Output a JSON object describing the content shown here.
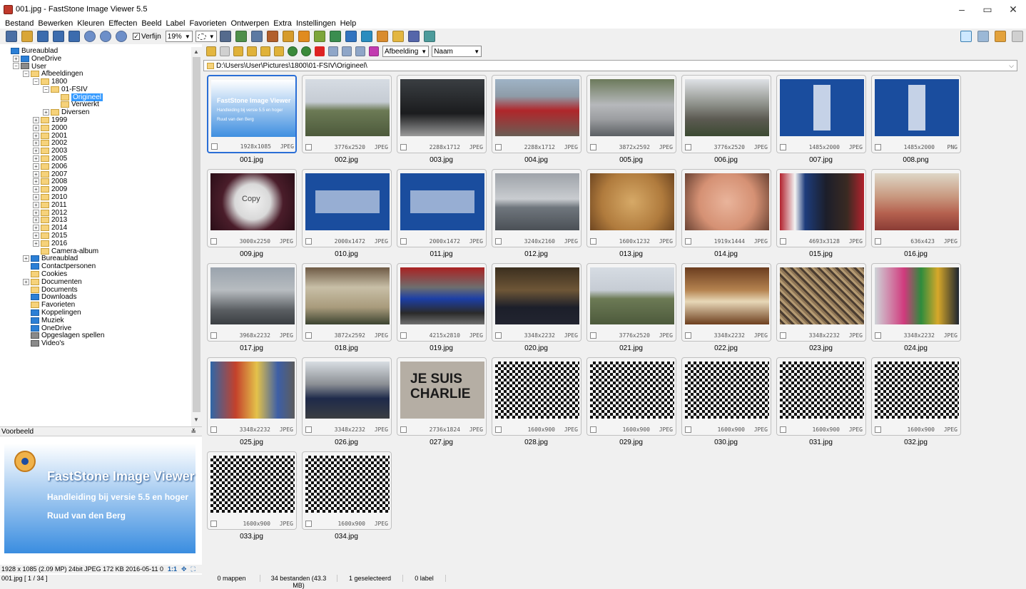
{
  "window": {
    "title": "001.jpg - FastStone Image Viewer 5.5",
    "min": "–",
    "max": "▭",
    "close": "✕"
  },
  "menu": [
    "Bestand",
    "Bewerken",
    "Kleuren",
    "Effecten",
    "Beeld",
    "Label",
    "Favorieten",
    "Ontwerpen",
    "Extra",
    "Instellingen",
    "Help"
  ],
  "toolbar": {
    "refine_label": "Verfijn",
    "zoom_value": "19%"
  },
  "nav_toolbar": {
    "sort_label": "Afbeelding",
    "sort_by": "Naam"
  },
  "path": "D:\\Users\\User\\Pictures\\1800\\01-FSIV\\Origineel\\",
  "tree": [
    {
      "label": "Bureaublad",
      "indent": 0,
      "exp": "",
      "icon": "blue"
    },
    {
      "label": "OneDrive",
      "indent": 1,
      "exp": "+",
      "icon": "blue"
    },
    {
      "label": "User",
      "indent": 1,
      "exp": "-",
      "icon": "grey"
    },
    {
      "label": "Afbeeldingen",
      "indent": 2,
      "exp": "-",
      "icon": "folder"
    },
    {
      "label": "1800",
      "indent": 3,
      "exp": "-",
      "icon": "folder"
    },
    {
      "label": "01-FSIV",
      "indent": 4,
      "exp": "-",
      "icon": "folder"
    },
    {
      "label": "Origineel",
      "indent": 5,
      "exp": "",
      "icon": "folder",
      "selected": true
    },
    {
      "label": "Verwerkt",
      "indent": 5,
      "exp": "",
      "icon": "folder"
    },
    {
      "label": "Diversen",
      "indent": 4,
      "exp": "+",
      "icon": "folder"
    },
    {
      "label": "1999",
      "indent": 3,
      "exp": "+",
      "icon": "folder"
    },
    {
      "label": "2000",
      "indent": 3,
      "exp": "+",
      "icon": "folder"
    },
    {
      "label": "2001",
      "indent": 3,
      "exp": "+",
      "icon": "folder"
    },
    {
      "label": "2002",
      "indent": 3,
      "exp": "+",
      "icon": "folder"
    },
    {
      "label": "2003",
      "indent": 3,
      "exp": "+",
      "icon": "folder"
    },
    {
      "label": "2005",
      "indent": 3,
      "exp": "+",
      "icon": "folder"
    },
    {
      "label": "2006",
      "indent": 3,
      "exp": "+",
      "icon": "folder"
    },
    {
      "label": "2007",
      "indent": 3,
      "exp": "+",
      "icon": "folder"
    },
    {
      "label": "2008",
      "indent": 3,
      "exp": "+",
      "icon": "folder"
    },
    {
      "label": "2009",
      "indent": 3,
      "exp": "+",
      "icon": "folder"
    },
    {
      "label": "2010",
      "indent": 3,
      "exp": "+",
      "icon": "folder"
    },
    {
      "label": "2011",
      "indent": 3,
      "exp": "+",
      "icon": "folder"
    },
    {
      "label": "2012",
      "indent": 3,
      "exp": "+",
      "icon": "folder"
    },
    {
      "label": "2013",
      "indent": 3,
      "exp": "+",
      "icon": "folder"
    },
    {
      "label": "2014",
      "indent": 3,
      "exp": "+",
      "icon": "folder"
    },
    {
      "label": "2015",
      "indent": 3,
      "exp": "+",
      "icon": "folder"
    },
    {
      "label": "2016",
      "indent": 3,
      "exp": "+",
      "icon": "folder"
    },
    {
      "label": "Camera-album",
      "indent": 3,
      "exp": "",
      "icon": "folder"
    },
    {
      "label": "Bureaublad",
      "indent": 2,
      "exp": "+",
      "icon": "blue"
    },
    {
      "label": "Contactpersonen",
      "indent": 2,
      "exp": "",
      "icon": "blue"
    },
    {
      "label": "Cookies",
      "indent": 2,
      "exp": "",
      "icon": "folder"
    },
    {
      "label": "Documenten",
      "indent": 2,
      "exp": "+",
      "icon": "folder"
    },
    {
      "label": "Documents",
      "indent": 2,
      "exp": "",
      "icon": "folder"
    },
    {
      "label": "Downloads",
      "indent": 2,
      "exp": "",
      "icon": "blue"
    },
    {
      "label": "Favorieten",
      "indent": 2,
      "exp": "",
      "icon": "folder"
    },
    {
      "label": "Koppelingen",
      "indent": 2,
      "exp": "",
      "icon": "blue"
    },
    {
      "label": "Muziek",
      "indent": 2,
      "exp": "",
      "icon": "blue"
    },
    {
      "label": "OneDrive",
      "indent": 2,
      "exp": "",
      "icon": "blue"
    },
    {
      "label": "Opgeslagen spellen",
      "indent": 2,
      "exp": "",
      "icon": "grey"
    },
    {
      "label": "Video's",
      "indent": 2,
      "exp": "",
      "icon": "grey"
    }
  ],
  "preview": {
    "header": "Voorbeeld",
    "title": "FastStone Image Viewer",
    "subtitle": "Handleiding bij versie 5.5 en hoger",
    "author": "Ruud van den Berg",
    "info": "1928 x 1085 (2.09 MP)  24bit  JPEG  172 KB  2016-05-11 0",
    "info_ratio": "1:1"
  },
  "status_left": "001.jpg [ 1 / 34 ]",
  "status": [
    "0 mappen",
    "34 bestanden (43.3 MB)",
    "1 geselecteerd",
    "0 label"
  ],
  "thumbs": [
    {
      "name": "001.jpg",
      "dim": "1928x1085",
      "fmt": "JPEG",
      "style": "fsiv",
      "selected": true
    },
    {
      "name": "002.jpg",
      "dim": "3776x2520",
      "fmt": "JPEG",
      "style": "sky"
    },
    {
      "name": "003.jpg",
      "dim": "2288x1712",
      "fmt": "JPEG",
      "style": "car"
    },
    {
      "name": "004.jpg",
      "dim": "2288x1712",
      "fmt": "JPEG",
      "style": "redcar"
    },
    {
      "name": "005.jpg",
      "dim": "3872x2592",
      "fmt": "JPEG",
      "style": "silver"
    },
    {
      "name": "006.jpg",
      "dim": "3776x2520",
      "fmt": "JPEG",
      "style": "church"
    },
    {
      "name": "007.jpg",
      "dim": "1485x2000",
      "fmt": "JPEG",
      "style": "sign"
    },
    {
      "name": "008.png",
      "dim": "1485x2000",
      "fmt": "PNG",
      "style": "sign"
    },
    {
      "name": "009.jpg",
      "dim": "3000x2250",
      "fmt": "JPEG",
      "style": "copy"
    },
    {
      "name": "010.jpg",
      "dim": "2000x1472",
      "fmt": "JPEG",
      "style": "sign2"
    },
    {
      "name": "011.jpg",
      "dim": "2000x1472",
      "fmt": "JPEG",
      "style": "sign2"
    },
    {
      "name": "012.jpg",
      "dim": "3240x2160",
      "fmt": "JPEG",
      "style": "beach"
    },
    {
      "name": "013.jpg",
      "dim": "1600x1232",
      "fmt": "JPEG",
      "style": "paper"
    },
    {
      "name": "014.jpg",
      "dim": "1919x1444",
      "fmt": "JPEG",
      "style": "eyes"
    },
    {
      "name": "015.jpg",
      "dim": "4693x3128",
      "fmt": "JPEG",
      "style": "obama"
    },
    {
      "name": "016.jpg",
      "dim": "636x423",
      "fmt": "JPEG",
      "style": "sisters"
    },
    {
      "name": "017.jpg",
      "dim": "3968x2232",
      "fmt": "JPEG",
      "style": "motel"
    },
    {
      "name": "018.jpg",
      "dim": "3872x2592",
      "fmt": "JPEG",
      "style": "arch"
    },
    {
      "name": "019.jpg",
      "dim": "4215x2810",
      "fmt": "JPEG",
      "style": "f1"
    },
    {
      "name": "020.jpg",
      "dim": "3348x2232",
      "fmt": "JPEG",
      "style": "night"
    },
    {
      "name": "021.jpg",
      "dim": "3776x2520",
      "fmt": "JPEG",
      "style": "sky"
    },
    {
      "name": "022.jpg",
      "dim": "3348x2232",
      "fmt": "JPEG",
      "style": "glass"
    },
    {
      "name": "023.jpg",
      "dim": "3348x2232",
      "fmt": "JPEG",
      "style": "locks"
    },
    {
      "name": "024.jpg",
      "dim": "3348x2232",
      "fmt": "JPEG",
      "style": "toys"
    },
    {
      "name": "025.jpg",
      "dim": "3348x2232",
      "fmt": "JPEG",
      "style": "graffiti"
    },
    {
      "name": "026.jpg",
      "dim": "3348x2232",
      "fmt": "JPEG",
      "style": "vans"
    },
    {
      "name": "027.jpg",
      "dim": "2736x1824",
      "fmt": "JPEG",
      "style": "charlie"
    },
    {
      "name": "028.jpg",
      "dim": "1600x900",
      "fmt": "JPEG",
      "style": "check"
    },
    {
      "name": "029.jpg",
      "dim": "1600x900",
      "fmt": "JPEG",
      "style": "check"
    },
    {
      "name": "030.jpg",
      "dim": "1600x900",
      "fmt": "JPEG",
      "style": "check"
    },
    {
      "name": "031.jpg",
      "dim": "1600x900",
      "fmt": "JPEG",
      "style": "check"
    },
    {
      "name": "032.jpg",
      "dim": "1600x900",
      "fmt": "JPEG",
      "style": "check"
    },
    {
      "name": "033.jpg",
      "dim": "1600x900",
      "fmt": "JPEG",
      "style": "check"
    },
    {
      "name": "034.jpg",
      "dim": "1600x900",
      "fmt": "JPEG",
      "style": "check"
    }
  ],
  "thumb_texts": {
    "fsiv_title": "FastStone Image Viewer",
    "fsiv_sub": "Handleiding bij versie 5.5 en hoger",
    "fsiv_author": "Ruud van den Berg",
    "copy_key": "Copy",
    "charlie_line1": "JE SUIS",
    "charlie_line2": "CHARLIE"
  }
}
